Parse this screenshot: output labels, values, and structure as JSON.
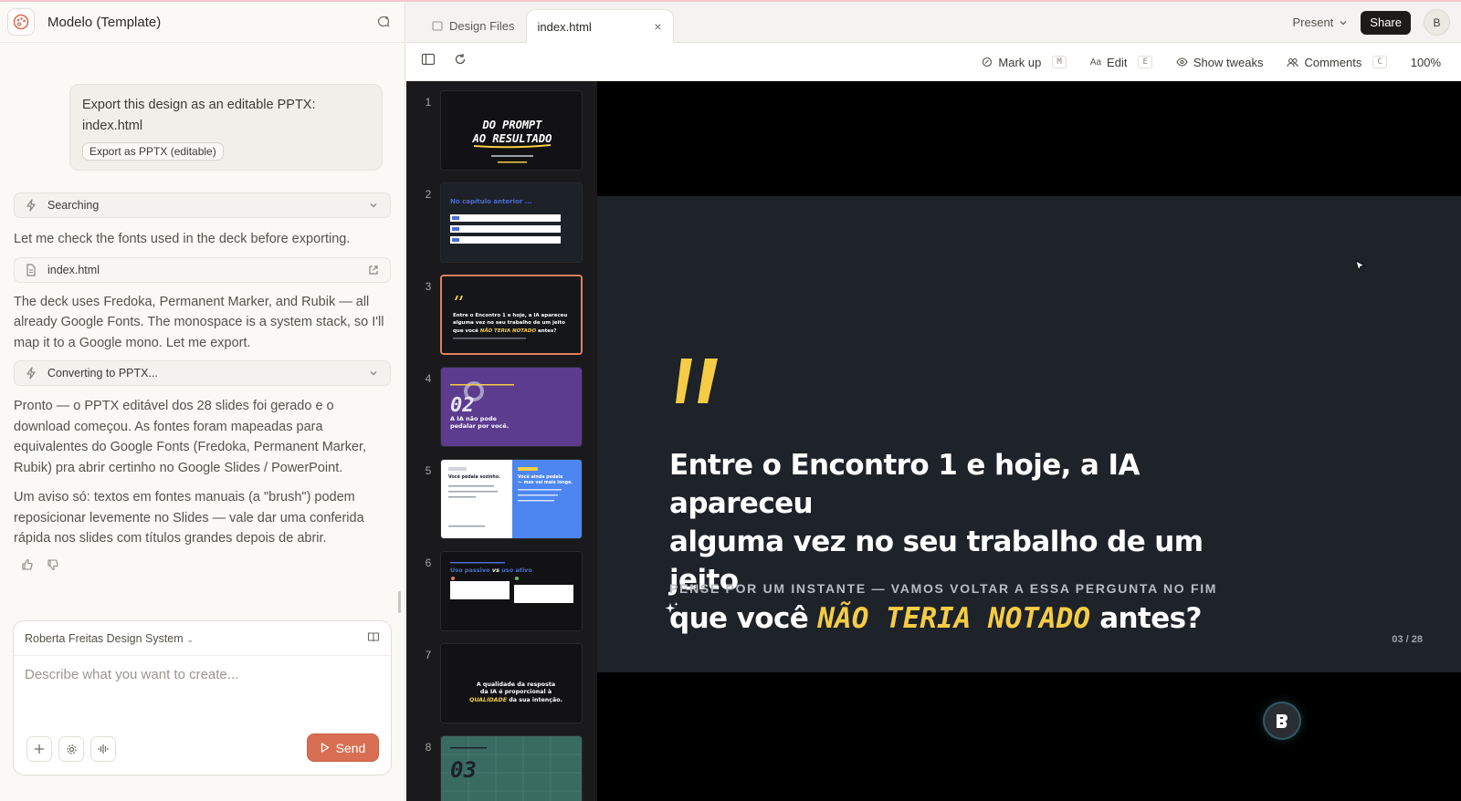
{
  "project": {
    "title": "Modelo (Template)"
  },
  "chat": {
    "user_message": "Export this design as an editable PPTX: index.html",
    "user_chip": "Export as PPTX (editable)",
    "tool_searching": "Searching",
    "msg_check_fonts": "Let me check the fonts used in the deck before exporting.",
    "file_ref": "index.html",
    "msg_fonts": "The deck uses Fredoka, Permanent Marker, and Rubik — all already Google Fonts. The monospace is a system stack, so I'll map it to a Google mono. Let me export.",
    "tool_converting": "Converting to PPTX...",
    "msg_done": "Pronto — o PPTX editável dos 28 slides foi gerado e o download começou. As fontes foram mapeadas para equivalentes do Google Fonts (Fredoka, Permanent Marker, Rubik) pra abrir certinho no Google Slides / PowerPoint.",
    "msg_warning": "Um aviso só: textos em fontes manuais (a \"brush\") podem reposicionar levemente no Slides — vale dar uma conferida rápida nos slides com títulos grandes depois de abrir."
  },
  "composer": {
    "design_system": "Roberta Freitas Design System",
    "placeholder": "Describe what you want to create...",
    "send_label": "Send"
  },
  "tabs": [
    {
      "label": "Design Files"
    },
    {
      "label": "index.html"
    }
  ],
  "header_actions": {
    "present": "Present",
    "share": "Share",
    "avatar_initial": "B"
  },
  "toolbar": {
    "markup": "Mark up",
    "markup_key": "M",
    "edit": "Edit",
    "edit_key": "E",
    "tweaks": "Show tweaks",
    "comments": "Comments",
    "comments_key": "C",
    "zoom": "100%"
  },
  "thumbnails": {
    "numbers": [
      "1",
      "2",
      "3",
      "4",
      "5",
      "6",
      "7",
      "8"
    ],
    "selected": 3,
    "t1": {
      "title_line1": "DO PROMPT",
      "title_line2": "AO RESULTADO"
    },
    "t2": {
      "title": "No capítulo anterior ..."
    },
    "t3": {
      "line1": "Entre o Encontro 1 e hoje, a IA apareceu",
      "line2": "alguma vez no seu trabalho de um jeito",
      "line3_pre": "que você",
      "line3_hl": "NÃO TERIA NOTADO",
      "line3_post": "antes?"
    },
    "t4": {
      "number": "02",
      "line1": "A IA não pode",
      "line2": "pedalar por você."
    },
    "t5": {
      "left_title": "Você pedala sozinho.",
      "right_title_1": "Você ainda pedala",
      "right_title_2": "— mas vai mais longe."
    },
    "t6": {
      "title_pre": "Uso passivo",
      "title_vs": "vs",
      "title_post": "uso ativo"
    },
    "t7": {
      "line1": "A qualidade da resposta",
      "line2": "da IA é proporcional à",
      "line3_hl": "QUALIDADE",
      "line3_post": "da sua intenção."
    },
    "t8": {
      "number": "03"
    }
  },
  "slide": {
    "quote_line1": "Entre o Encontro 1 e hoje, a IA apareceu",
    "quote_line2": "alguma vez no seu trabalho de um jeito",
    "quote_line3_pre": "que você",
    "quote_highlight": "NÃO TERIA NOTADO",
    "quote_line3_post": "antes?",
    "subtitle": "PENSE POR UM INSTANTE — VAMOS VOLTAR A ESSA PERGUNTA NO FIM",
    "page": "03 / 28"
  },
  "colors": {
    "accent": "#d86f52",
    "highlight_yellow": "#f5cc45",
    "slide_bg": "#1e2229",
    "selected_thumb_border": "#e0805f"
  }
}
